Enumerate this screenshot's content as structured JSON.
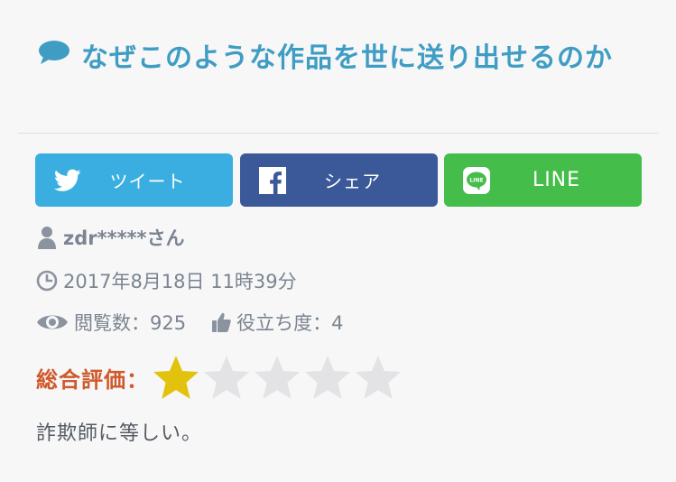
{
  "review": {
    "title": "なぜこのような作品を世に送り出せるのか",
    "share": {
      "twitter_label": "ツイート",
      "facebook_label": "シェア",
      "line_label": "LINE"
    },
    "author": "zdr*****さん",
    "date": "2017年8月18日 11時39分",
    "views_label": "閲覧数：925",
    "helpful_label": "役立ち度：4",
    "rating_label": "総合評価：",
    "rating": {
      "value": 1,
      "max": 5
    },
    "comment": "詐欺師に等しい。"
  },
  "colors": {
    "title": "#3f9dc4",
    "twitter": "#3aaee0",
    "facebook": "#3b5998",
    "line": "#45bd4b",
    "rating_label": "#cf5a2b",
    "star_on": "#e2c20c",
    "star_off": "#e3e3e5"
  },
  "icons": {
    "title": "speech-bubble-icon",
    "twitter": "twitter-bird-icon",
    "facebook": "facebook-f-icon",
    "line": "line-icon",
    "author": "user-icon",
    "date": "clock-icon",
    "views": "eye-icon",
    "helpful": "thumbs-up-icon"
  }
}
